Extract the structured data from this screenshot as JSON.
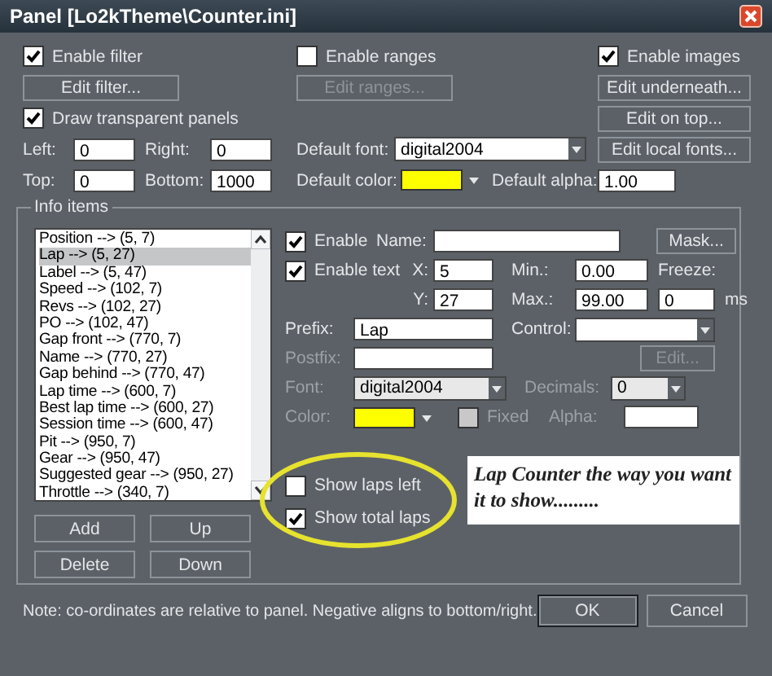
{
  "window": {
    "title": "Panel [Lo2kTheme\\Counter.ini]"
  },
  "filter": {
    "checkbox": {
      "label": "Enable filter",
      "checked": true
    },
    "button": {
      "label": "Edit filter..."
    }
  },
  "ranges": {
    "checkbox": {
      "label": "Enable ranges",
      "checked": false
    },
    "button": {
      "label": "Edit ranges...",
      "disabled": true
    }
  },
  "images": {
    "checkbox": {
      "label": "Enable images",
      "checked": true
    },
    "buttons": [
      {
        "label": "Edit underneath..."
      },
      {
        "label": "Edit on top..."
      }
    ]
  },
  "transparent": {
    "label": "Draw transparent panels",
    "checked": true
  },
  "left": {
    "label": "Left:",
    "value": "0"
  },
  "right": {
    "label": "Right:",
    "value": "0"
  },
  "top": {
    "label": "Top:",
    "value": "0"
  },
  "bottom": {
    "label": "Bottom:",
    "value": "1000"
  },
  "default_font": {
    "label": "Default font:",
    "value": "digital2004"
  },
  "edit_fonts_button": {
    "label": "Edit local fonts..."
  },
  "default_color": {
    "label": "Default color:",
    "color": "#ffff00"
  },
  "default_alpha": {
    "label": "Default alpha:",
    "value": "1.00"
  },
  "info_items": {
    "title": "Info items",
    "items": [
      {
        "label": "Position --> (5, 7)",
        "selected": false
      },
      {
        "label": "Lap --> (5, 27)",
        "selected": true
      },
      {
        "label": "Label --> (5, 47)",
        "selected": false
      },
      {
        "label": "Speed --> (102, 7)",
        "selected": false
      },
      {
        "label": "Revs --> (102, 27)",
        "selected": false
      },
      {
        "label": "PO --> (102, 47)",
        "selected": false
      },
      {
        "label": "Gap front --> (770, 7)",
        "selected": false
      },
      {
        "label": "Name --> (770, 27)",
        "selected": false
      },
      {
        "label": "Gap behind --> (770, 47)",
        "selected": false
      },
      {
        "label": "Lap time --> (600, 7)",
        "selected": false
      },
      {
        "label": "Best lap time --> (600, 27)",
        "selected": false
      },
      {
        "label": "Session time --> (600, 47)",
        "selected": false
      },
      {
        "label": "Pit --> (950, 7)",
        "selected": false
      },
      {
        "label": "Gear --> (950, 47)",
        "selected": false
      },
      {
        "label": "Suggested gear --> (950, 27)",
        "selected": false
      },
      {
        "label": "Throttle --> (340, 7)",
        "selected": false
      }
    ],
    "buttons": [
      {
        "label": "Add"
      },
      {
        "label": "Up"
      },
      {
        "label": "Delete"
      },
      {
        "label": "Down"
      }
    ]
  },
  "item": {
    "enable": {
      "label": "Enable",
      "checked": true
    },
    "name": {
      "label": "Name:"
    },
    "mask_button": {
      "label": "Mask..."
    },
    "enable_text": {
      "label": "Enable text",
      "checked": true
    },
    "x": {
      "label": "X:",
      "value": "5"
    },
    "y": {
      "label": "Y:",
      "value": "27"
    },
    "min": {
      "label": "Min.:",
      "value": "0.00"
    },
    "max": {
      "label": "Max.:",
      "value": "99.00"
    },
    "freeze": {
      "label": "Freeze:",
      "value": "0",
      "unit": "ms"
    },
    "prefix": {
      "label": "Prefix:",
      "value": "Lap"
    },
    "control": {
      "label": "Control:"
    },
    "postfix": {
      "label": "Postfix:",
      "disabled": true
    },
    "edit_button": {
      "label": "Edit...",
      "disabled": true
    },
    "font": {
      "label": "Font:",
      "value": "digital2004",
      "disabled": true
    },
    "decimals": {
      "label": "Decimals:",
      "value": "0",
      "disabled": true
    },
    "color": {
      "label": "Color:",
      "color": "#ffff00",
      "disabled": true
    },
    "fixed": {
      "label": "Fixed",
      "checked": false,
      "disabled": true
    },
    "alpha": {
      "label": "Alpha:",
      "disabled": true
    },
    "show_laps_left": {
      "label": "Show laps left",
      "checked": false
    },
    "show_total_laps": {
      "label": "Show total laps",
      "checked": true
    }
  },
  "caption": "Lap Counter the way you want it to show.........",
  "note": "Note: co-ordinates are relative to panel. Negative aligns to bottom/right.",
  "buttons": [
    {
      "label": "OK",
      "default": true
    },
    {
      "label": "Cancel",
      "default": false
    }
  ]
}
